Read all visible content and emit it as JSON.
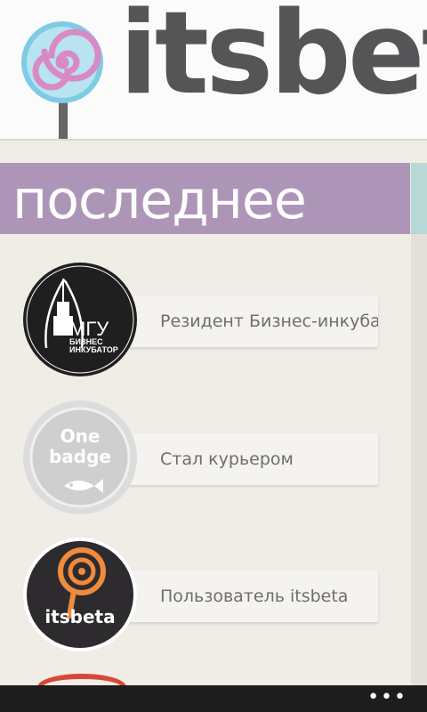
{
  "header": {
    "brand": "itsbeta",
    "logo_icon": "lollipop-icon"
  },
  "section": {
    "title": "последнее",
    "color": "#ad95b8"
  },
  "badges": [
    {
      "label": "Резидент Бизнес-инкубатора МГУ",
      "icon": "mgu-incubator-badge",
      "badge_text": "МГУ",
      "badge_sub1": "БИЗНЕС",
      "badge_sub2": "ИНКУБАТОР"
    },
    {
      "label": "Стал курьером",
      "icon": "one-badge",
      "badge_text1": "One",
      "badge_text2": "badge"
    },
    {
      "label": "Пользователь itsbeta",
      "icon": "itsbeta-user-badge",
      "badge_text": "itsbeta"
    }
  ],
  "appbar": {
    "more_label": "•••"
  }
}
